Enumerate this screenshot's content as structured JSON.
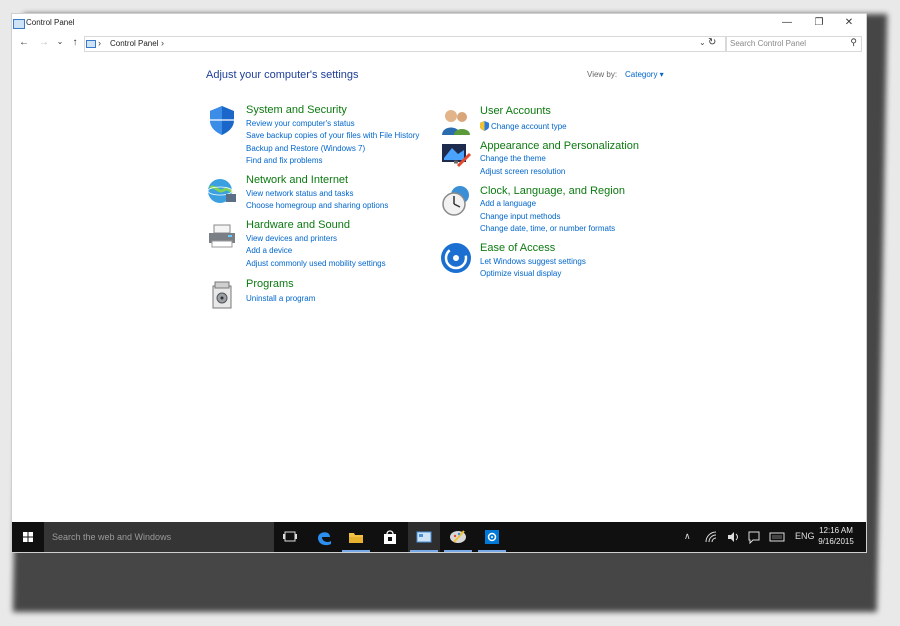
{
  "window": {
    "title": "Control Panel",
    "minimize_glyph": "—",
    "restore_glyph": "❐",
    "close_glyph": "✕"
  },
  "nav": {
    "back_glyph": "←",
    "forward_glyph": "→",
    "recent_glyph": "⌄",
    "up_glyph": "↑",
    "separator": "›",
    "breadcrumb": "Control Panel",
    "dropdown_glyph": "⌄",
    "refresh_glyph": "↻",
    "search_placeholder": "Search Control Panel",
    "search_glyph": "⚲"
  },
  "main": {
    "heading": "Adjust your computer's settings",
    "view_by_label": "View by:",
    "view_by_value": "Category ▾"
  },
  "categories_left": [
    {
      "icon": "shield-icon",
      "title": "System and Security",
      "links": [
        "Review your computer's status",
        "Save backup copies of your files with File History",
        "Backup and Restore (Windows 7)",
        "Find and fix problems"
      ]
    },
    {
      "icon": "globe-network-icon",
      "title": "Network and Internet",
      "links": [
        "View network status and tasks",
        "Choose homegroup and sharing options"
      ]
    },
    {
      "icon": "printer-icon",
      "title": "Hardware and Sound",
      "links": [
        "View devices and printers",
        "Add a device",
        "Adjust commonly used mobility settings"
      ]
    },
    {
      "icon": "programs-icon",
      "title": "Programs",
      "links": [
        "Uninstall a program"
      ]
    }
  ],
  "categories_right": [
    {
      "icon": "users-icon",
      "title": "User Accounts",
      "links": [
        "Change account type"
      ]
    },
    {
      "icon": "monitor-paint-icon",
      "title": "Appearance and Personalization",
      "links": [
        "Change the theme",
        "Adjust screen resolution"
      ]
    },
    {
      "icon": "clock-globe-icon",
      "title": "Clock, Language, and Region",
      "links": [
        "Add a language",
        "Change input methods",
        "Change date, time, or number formats"
      ]
    },
    {
      "icon": "ease-of-access-icon",
      "title": "Ease of Access",
      "links": [
        "Let Windows suggest settings",
        "Optimize visual display"
      ]
    }
  ],
  "taskbar": {
    "search_placeholder": "Search the web and Windows",
    "tray_chevron": "∧",
    "language": "ENG",
    "time": "12:16 AM",
    "date": "9/16/2015"
  },
  "colors": {
    "heading": "#1e3f99",
    "category_title": "#0c7a10",
    "link": "#0066cc",
    "taskbar": "#101010",
    "accent": "#0078d7"
  }
}
